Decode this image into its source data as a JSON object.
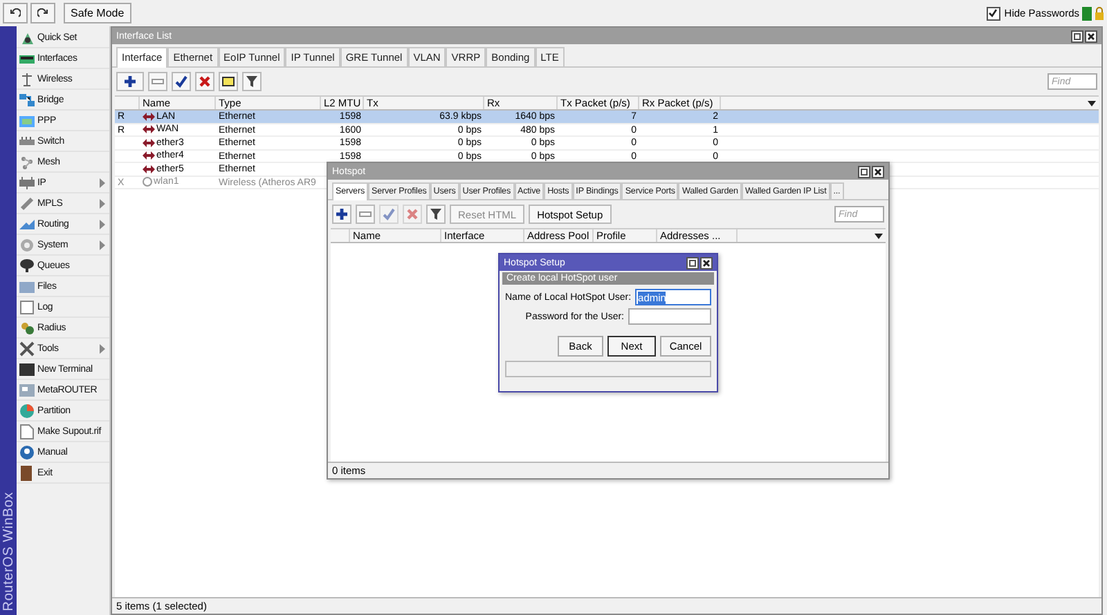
{
  "toolbar": {
    "safe_mode": "Safe Mode",
    "hide_passwords": {
      "label": "Hide Passwords",
      "checked": true
    }
  },
  "sidebar": {
    "brand": "RouterOS WinBox",
    "items": [
      {
        "label": "Quick Set",
        "submenu": false
      },
      {
        "label": "Interfaces",
        "submenu": false
      },
      {
        "label": "Wireless",
        "submenu": false
      },
      {
        "label": "Bridge",
        "submenu": false
      },
      {
        "label": "PPP",
        "submenu": false
      },
      {
        "label": "Switch",
        "submenu": false
      },
      {
        "label": "Mesh",
        "submenu": false
      },
      {
        "label": "IP",
        "submenu": true
      },
      {
        "label": "MPLS",
        "submenu": true
      },
      {
        "label": "Routing",
        "submenu": true
      },
      {
        "label": "System",
        "submenu": true
      },
      {
        "label": "Queues",
        "submenu": false
      },
      {
        "label": "Files",
        "submenu": false
      },
      {
        "label": "Log",
        "submenu": false
      },
      {
        "label": "Radius",
        "submenu": false
      },
      {
        "label": "Tools",
        "submenu": true
      },
      {
        "label": "New Terminal",
        "submenu": false
      },
      {
        "label": "MetaROUTER",
        "submenu": false
      },
      {
        "label": "Partition",
        "submenu": false
      },
      {
        "label": "Make Supout.rif",
        "submenu": false
      },
      {
        "label": "Manual",
        "submenu": false
      },
      {
        "label": "Exit",
        "submenu": false
      }
    ]
  },
  "interface_list": {
    "title": "Interface List",
    "tabs": [
      {
        "label": "Interface",
        "selected": true
      },
      {
        "label": "Ethernet",
        "selected": false
      },
      {
        "label": "EoIP Tunnel",
        "selected": false
      },
      {
        "label": "IP Tunnel",
        "selected": false
      },
      {
        "label": "GRE Tunnel",
        "selected": false
      },
      {
        "label": "VLAN",
        "selected": false
      },
      {
        "label": "VRRP",
        "selected": false
      },
      {
        "label": "Bonding",
        "selected": false
      },
      {
        "label": "LTE",
        "selected": false
      }
    ],
    "find_placeholder": "Find",
    "columns": [
      "Name",
      "Type",
      "L2 MTU",
      "Tx",
      "Rx",
      "Tx Packet (p/s)",
      "Rx Packet (p/s)"
    ],
    "rows": [
      {
        "flag": "R",
        "name": "LAN",
        "type": "Ethernet",
        "l2mtu": "1598",
        "tx": "63.9 kbps",
        "rx": "1640 bps",
        "tx_packet": "7",
        "rx_packet": "2",
        "selected": true,
        "disabled": false
      },
      {
        "flag": "R",
        "name": "WAN",
        "type": "Ethernet",
        "l2mtu": "1600",
        "tx": "0 bps",
        "rx": "480 bps",
        "tx_packet": "0",
        "rx_packet": "1",
        "selected": false,
        "disabled": false
      },
      {
        "name": "ether3",
        "type": "Ethernet",
        "l2mtu": "1598",
        "tx": "0 bps",
        "rx": "0 bps",
        "tx_packet": "0",
        "rx_packet": "0",
        "selected": false,
        "disabled": false
      },
      {
        "name": "ether4",
        "type": "Ethernet",
        "l2mtu": "1598",
        "tx": "0 bps",
        "rx": "0 bps",
        "tx_packet": "0",
        "rx_packet": "0",
        "selected": false,
        "disabled": false
      },
      {
        "name": "ether5",
        "type": "Ethernet",
        "selected": false,
        "disabled": false
      },
      {
        "flag": "X",
        "name": "wlan1",
        "type": "Wireless (Atheros AR9",
        "selected": false,
        "disabled": true
      }
    ],
    "status": "5 items (1 selected)"
  },
  "hotspot": {
    "title": "Hotspot",
    "tabs": [
      {
        "label": "Servers",
        "selected": true
      },
      {
        "label": "Server Profiles",
        "selected": false
      },
      {
        "label": "Users",
        "selected": false
      },
      {
        "label": "User Profiles",
        "selected": false
      },
      {
        "label": "Active",
        "selected": false
      },
      {
        "label": "Hosts",
        "selected": false
      },
      {
        "label": "IP Bindings",
        "selected": false
      },
      {
        "label": "Service Ports",
        "selected": false
      },
      {
        "label": "Walled Garden",
        "selected": false
      },
      {
        "label": "Walled Garden IP List",
        "selected": false
      },
      {
        "label": "...",
        "selected": false
      }
    ],
    "buttons": [
      "Reset HTML",
      "Hotspot Setup"
    ],
    "find_placeholder": "Find",
    "columns": [
      "Name",
      "Interface",
      "Address Pool",
      "Profile",
      "Addresses ..."
    ],
    "status": "0 items"
  },
  "setup": {
    "title": "Hotspot Setup",
    "subtitle": "Create local HotSpot user",
    "fields": [
      {
        "label": "Name of Local HotSpot User:",
        "value": "admin",
        "selected": true
      },
      {
        "label": "Password for the User:",
        "selected": false
      }
    ],
    "buttons": [
      {
        "label": "Back",
        "default": false
      },
      {
        "label": "Next",
        "default": true
      },
      {
        "label": "Cancel",
        "default": false
      }
    ]
  }
}
